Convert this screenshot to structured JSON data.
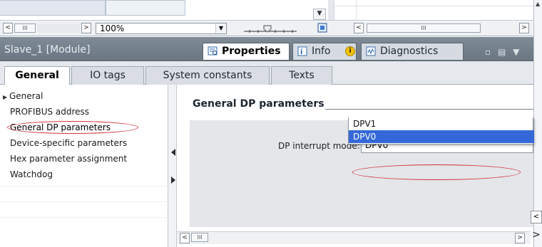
{
  "toolbar": {
    "zoom_value": "100%",
    "scroll_left": "<",
    "scroll_right": ">",
    "scroll_thumb": "III",
    "dropdown_arrow": "▼"
  },
  "inspector": {
    "title": "Slave_1 [Module]",
    "tabs": {
      "properties": "Properties",
      "info": "Info",
      "info_badge": "i",
      "diagnostics": "Diagnostics"
    },
    "window_controls": "▫ ▤ ▼"
  },
  "subtabs": [
    "General",
    "IO tags",
    "System constants",
    "Texts"
  ],
  "nav": {
    "items": [
      {
        "label": "General",
        "caret": "▶"
      },
      {
        "label": "PROFIBUS address"
      },
      {
        "label": "General DP parameters"
      },
      {
        "label": "Device-specific parameters"
      },
      {
        "label": "Hex parameter assignment"
      },
      {
        "label": "Watchdog"
      }
    ]
  },
  "content": {
    "section_title": "General DP parameters",
    "param_label": "DP interrupt mode:",
    "param_value": "DPV0",
    "options": [
      "DPV1",
      "DPV0"
    ],
    "selected_option": "DPV0",
    "hscroll_thumb": "III"
  },
  "colors": {
    "header_bg": "#737f8a",
    "selection": "#3468d9",
    "annotation": "#d4333b"
  }
}
